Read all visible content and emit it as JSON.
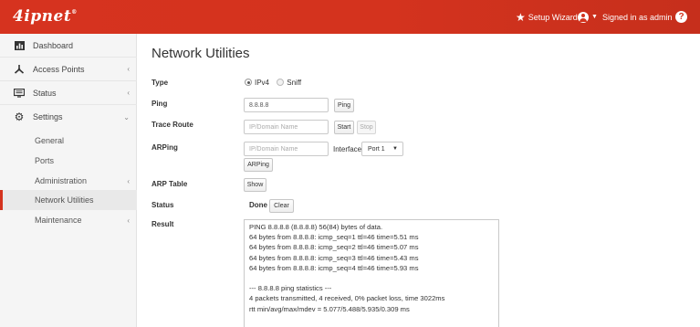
{
  "header": {
    "logo": "4ipnet",
    "logo_mark": "®",
    "setup_wizard": "Setup Wizard",
    "signed_in": "Signed in as admin",
    "help": "?"
  },
  "sidebar": {
    "items": [
      {
        "label": "Dashboard",
        "icon": "bar-chart-icon"
      },
      {
        "label": "Access Points",
        "icon": "access-point-icon"
      },
      {
        "label": "Status",
        "icon": "monitor-icon"
      },
      {
        "label": "Settings",
        "icon": "gear-icon"
      }
    ],
    "sub_items": [
      {
        "label": "General"
      },
      {
        "label": "Ports"
      },
      {
        "label": "Administration"
      },
      {
        "label": "Network Utilities"
      },
      {
        "label": "Maintenance"
      }
    ]
  },
  "main": {
    "title": "Network Utilities",
    "type": {
      "label": "Type",
      "options": [
        "IPv4",
        "Sniff"
      ],
      "selected": "IPv4"
    },
    "ping": {
      "label": "Ping",
      "value": "8.8.8.8",
      "button": "Ping"
    },
    "trace": {
      "label": "Trace Route",
      "placeholder": "IP/Domain Name",
      "start": "Start",
      "stop": "Stop"
    },
    "arping": {
      "label": "ARPing",
      "placeholder": "IP/Domain Name",
      "interface_label": "Interface",
      "interface_value": "Port 1",
      "button": "ARPing"
    },
    "arp_table": {
      "label": "ARP Table",
      "button": "Show"
    },
    "status": {
      "label": "Status",
      "value": "Done",
      "clear": "Clear"
    },
    "result": {
      "label": "Result",
      "text": "PING 8.8.8.8 (8.8.8.8) 56(84) bytes of data.\n64 bytes from 8.8.8.8: icmp_seq=1 ttl=46 time=5.51 ms\n64 bytes from 8.8.8.8: icmp_seq=2 ttl=46 time=5.07 ms\n64 bytes from 8.8.8.8: icmp_seq=3 ttl=46 time=5.43 ms\n64 bytes from 8.8.8.8: icmp_seq=4 ttl=46 time=5.93 ms\n\n--- 8.8.8.8 ping statistics ---\n4 packets transmitted, 4 received, 0% packet loss, time 3022ms\nrtt min/avg/max/mdev = 5.077/5.488/5.935/0.309 ms"
    }
  },
  "colors": {
    "brand": "#d4331e",
    "sidebar_bg": "#f5f5f5"
  }
}
